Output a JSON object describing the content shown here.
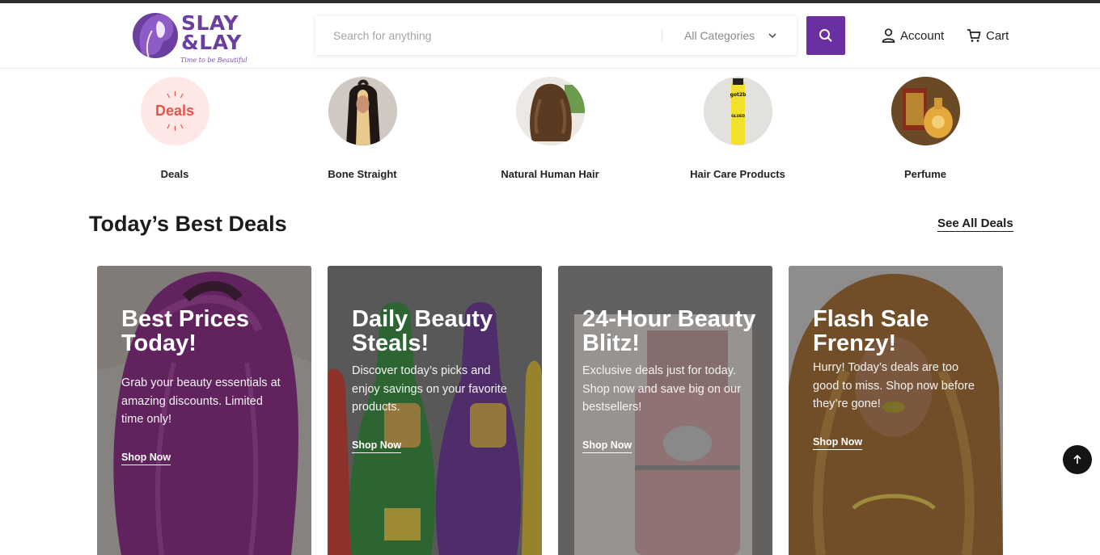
{
  "brand": {
    "line1": "SLAY",
    "line2": "&LAY",
    "tagline": "Time to be Beautiful",
    "color": "#6b3fa0"
  },
  "search": {
    "placeholder": "Search for anything",
    "category_selected": "All Categories",
    "button_icon": "search-icon",
    "button_color": "#6a2fa1"
  },
  "nav": {
    "account_label": "Account",
    "account_icon": "user-icon",
    "cart_label": "Cart",
    "cart_icon": "cart-icon"
  },
  "categories": [
    {
      "label": "Deals",
      "badge_text": "Deals"
    },
    {
      "label": "Bone Straight"
    },
    {
      "label": "Natural Human Hair"
    },
    {
      "label": "Hair Care Products",
      "product_text": "got2b GLUED"
    },
    {
      "label": "Perfume"
    }
  ],
  "section": {
    "title": "Today’s Best Deals",
    "see_all_label": "See All Deals"
  },
  "deals": [
    {
      "title": "Best Prices Today!",
      "description": "Grab your beauty essentials at amazing discounts. Limited time only!",
      "cta": "Shop Now"
    },
    {
      "title": "Daily Beauty Steals!",
      "description": "Discover today’s picks and enjoy savings on your favorite products.",
      "cta": "Shop Now"
    },
    {
      "title": "24-Hour Beauty Blitz!",
      "description": "Exclusive deals just for today. Shop now and save big on our bestsellers!",
      "cta": "Shop Now"
    },
    {
      "title": "Flash Sale Frenzy!",
      "description": "Hurry! Today’s deals are too good to miss. Shop now before they’re gone!",
      "cta": "Shop Now"
    }
  ],
  "back_to_top_icon": "arrow-up-icon"
}
